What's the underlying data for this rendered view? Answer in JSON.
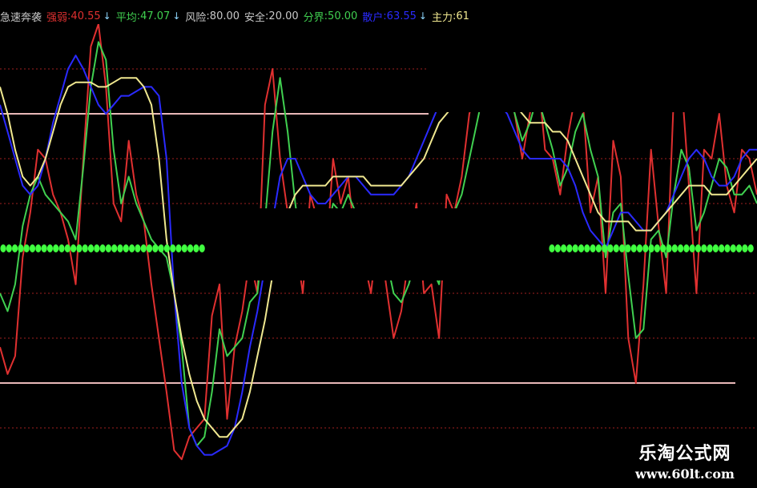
{
  "colors": {
    "background": "#000000",
    "red": "#e03030",
    "green": "#40d050",
    "blue": "#2a2aff",
    "yellow": "#f0e890",
    "grid": "#a02020",
    "level": "#e8b8b8",
    "dot": "#40ff40",
    "gray": "#c8c8c8",
    "arrow": "#8fd8ff"
  },
  "legend": {
    "indicator": "急速奔袭",
    "items": [
      {
        "label": "强弱",
        "value": "40.55",
        "color": "#e03030",
        "arrow": "↓"
      },
      {
        "label": "平均",
        "value": "47.07",
        "color": "#40d050",
        "arrow": "↓"
      },
      {
        "label": "风险",
        "value": "80.00",
        "color": "#c8c8c8",
        "arrow": ""
      },
      {
        "label": "安全",
        "value": "20.00",
        "color": "#c8c8c8",
        "arrow": ""
      },
      {
        "label": "分界",
        "value": "50.00",
        "color": "#40d050",
        "arrow": ""
      },
      {
        "label": "散户",
        "value": "63.55",
        "color": "#2a2aff",
        "arrow": "↓"
      },
      {
        "label": "主力",
        "value": "61",
        "color": "#f0e890",
        "arrow": ""
      }
    ]
  },
  "watermark": {
    "title": "乐淘公式网",
    "url": "www.60lt.com"
  },
  "chart_data": {
    "type": "line",
    "ylim": [
      0,
      100
    ],
    "grid": true,
    "x": [
      0,
      3,
      6,
      9,
      12,
      15,
      18,
      21,
      24,
      27,
      30,
      33,
      36,
      39,
      42,
      45,
      48,
      51,
      54,
      57,
      60,
      63,
      66,
      69,
      72,
      75,
      78,
      81,
      84,
      87,
      90,
      93,
      96,
      99,
      102,
      105,
      108,
      111,
      114,
      117,
      120,
      123,
      126,
      129,
      132,
      135,
      138,
      141,
      144,
      147,
      150,
      153,
      156,
      159,
      162,
      165,
      168,
      171,
      174,
      177,
      180,
      183,
      186,
      189,
      192,
      195,
      198,
      201,
      204,
      207,
      210,
      213,
      216,
      219,
      222,
      225,
      228,
      231,
      234,
      237,
      240,
      243,
      246,
      249,
      252,
      255,
      258,
      261,
      264,
      267,
      270,
      273,
      276,
      279,
      282,
      285,
      288,
      291,
      294,
      297,
      300
    ],
    "levels": [
      80,
      20
    ],
    "dotted_band": 50,
    "series": [
      {
        "name": "强弱",
        "color": "#e03030",
        "values": [
          28,
          22,
          26,
          48,
          58,
          72,
          70,
          62,
          58,
          52,
          42,
          70,
          95,
          100,
          86,
          60,
          56,
          74,
          62,
          56,
          42,
          30,
          18,
          5,
          3,
          8,
          10,
          12,
          35,
          42,
          12,
          28,
          36,
          48,
          40,
          82,
          90,
          70,
          58,
          52,
          40,
          62,
          56,
          45,
          70,
          60,
          66,
          50,
          48,
          40,
          55,
          42,
          30,
          36,
          48,
          60,
          40,
          42,
          30,
          62,
          58,
          66,
          80,
          86,
          92,
          95,
          90,
          88,
          80,
          70,
          80,
          90,
          72,
          70,
          62,
          75,
          84,
          83,
          58,
          66,
          40,
          74,
          66,
          30,
          20,
          42,
          72,
          55,
          40,
          84,
          88,
          64,
          40,
          72,
          70,
          80,
          64,
          58,
          72,
          70,
          62
        ]
      },
      {
        "name": "平均",
        "color": "#40d050",
        "values": [
          40,
          36,
          42,
          55,
          62,
          66,
          62,
          60,
          58,
          56,
          52,
          68,
          86,
          96,
          92,
          72,
          60,
          66,
          60,
          56,
          52,
          50,
          48,
          40,
          28,
          10,
          6,
          8,
          18,
          32,
          26,
          28,
          30,
          38,
          40,
          56,
          76,
          88,
          76,
          60,
          48,
          54,
          56,
          52,
          60,
          58,
          62,
          58,
          52,
          46,
          52,
          48,
          40,
          38,
          42,
          48,
          44,
          46,
          42,
          56,
          58,
          62,
          70,
          78,
          86,
          90,
          88,
          86,
          80,
          74,
          78,
          84,
          78,
          72,
          64,
          68,
          76,
          80,
          72,
          66,
          48,
          58,
          60,
          44,
          30,
          32,
          52,
          54,
          48,
          62,
          72,
          68,
          54,
          58,
          64,
          70,
          68,
          62,
          62,
          64,
          60
        ]
      },
      {
        "name": "散户",
        "color": "#2a2aff",
        "values": [
          82,
          76,
          70,
          64,
          62,
          64,
          70,
          78,
          84,
          90,
          93,
          90,
          86,
          82,
          80,
          82,
          84,
          84,
          85,
          86,
          86,
          84,
          70,
          40,
          20,
          10,
          6,
          4,
          4,
          5,
          6,
          10,
          18,
          28,
          36,
          46,
          56,
          66,
          70,
          70,
          66,
          62,
          60,
          60,
          62,
          64,
          66,
          66,
          64,
          62,
          62,
          62,
          62,
          64,
          66,
          70,
          74,
          78,
          82,
          86,
          88,
          90,
          90,
          88,
          86,
          84,
          82,
          80,
          76,
          72,
          70,
          70,
          70,
          70,
          70,
          68,
          64,
          58,
          54,
          52,
          50,
          54,
          58,
          58,
          56,
          54,
          54,
          56,
          58,
          62,
          66,
          70,
          72,
          70,
          66,
          64,
          64,
          66,
          70,
          72,
          72
        ]
      },
      {
        "name": "主力",
        "color": "#f0e890",
        "values": [
          86,
          80,
          72,
          66,
          64,
          66,
          70,
          76,
          82,
          86,
          87,
          87,
          87,
          86,
          86,
          87,
          88,
          88,
          88,
          86,
          82,
          70,
          52,
          40,
          30,
          22,
          16,
          12,
          10,
          8,
          8,
          10,
          12,
          18,
          26,
          34,
          44,
          52,
          58,
          62,
          64,
          64,
          64,
          64,
          66,
          66,
          66,
          66,
          66,
          64,
          64,
          64,
          64,
          64,
          66,
          68,
          70,
          74,
          78,
          80,
          82,
          84,
          84,
          84,
          84,
          84,
          84,
          84,
          82,
          80,
          78,
          78,
          78,
          76,
          76,
          74,
          70,
          66,
          62,
          58,
          56,
          56,
          56,
          56,
          54,
          54,
          54,
          56,
          58,
          60,
          62,
          64,
          64,
          64,
          62,
          62,
          62,
          64,
          66,
          68,
          70
        ]
      }
    ]
  }
}
